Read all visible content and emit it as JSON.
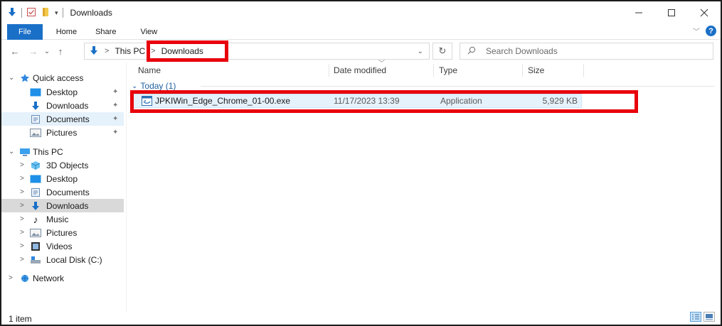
{
  "window": {
    "title": "Downloads"
  },
  "ribbon": {
    "tabs": [
      "File",
      "Home",
      "Share",
      "View"
    ],
    "help": "?"
  },
  "address": {
    "crumbs": [
      "This PC",
      "Downloads"
    ],
    "search_placeholder": "Search Downloads"
  },
  "sidebar": {
    "quick_access": "Quick access",
    "quick_items": [
      "Desktop",
      "Downloads",
      "Documents",
      "Pictures"
    ],
    "this_pc": "This PC",
    "pc_items": [
      "3D Objects",
      "Desktop",
      "Documents",
      "Downloads",
      "Music",
      "Pictures",
      "Videos",
      "Local Disk (C:)"
    ],
    "network": "Network"
  },
  "columns": {
    "name": "Name",
    "date": "Date modified",
    "type": "Type",
    "size": "Size"
  },
  "group": {
    "label": "Today (1)"
  },
  "files": [
    {
      "name": "JPKIWin_Edge_Chrome_01-00.exe",
      "date": "11/17/2023 13:39",
      "type": "Application",
      "size": "5,929 KB"
    }
  ],
  "status": {
    "count": "1 item"
  },
  "colors": {
    "accent": "#1a6fc7",
    "highlight_box": "#e8000b",
    "selected_row": "#e5f1fb"
  }
}
